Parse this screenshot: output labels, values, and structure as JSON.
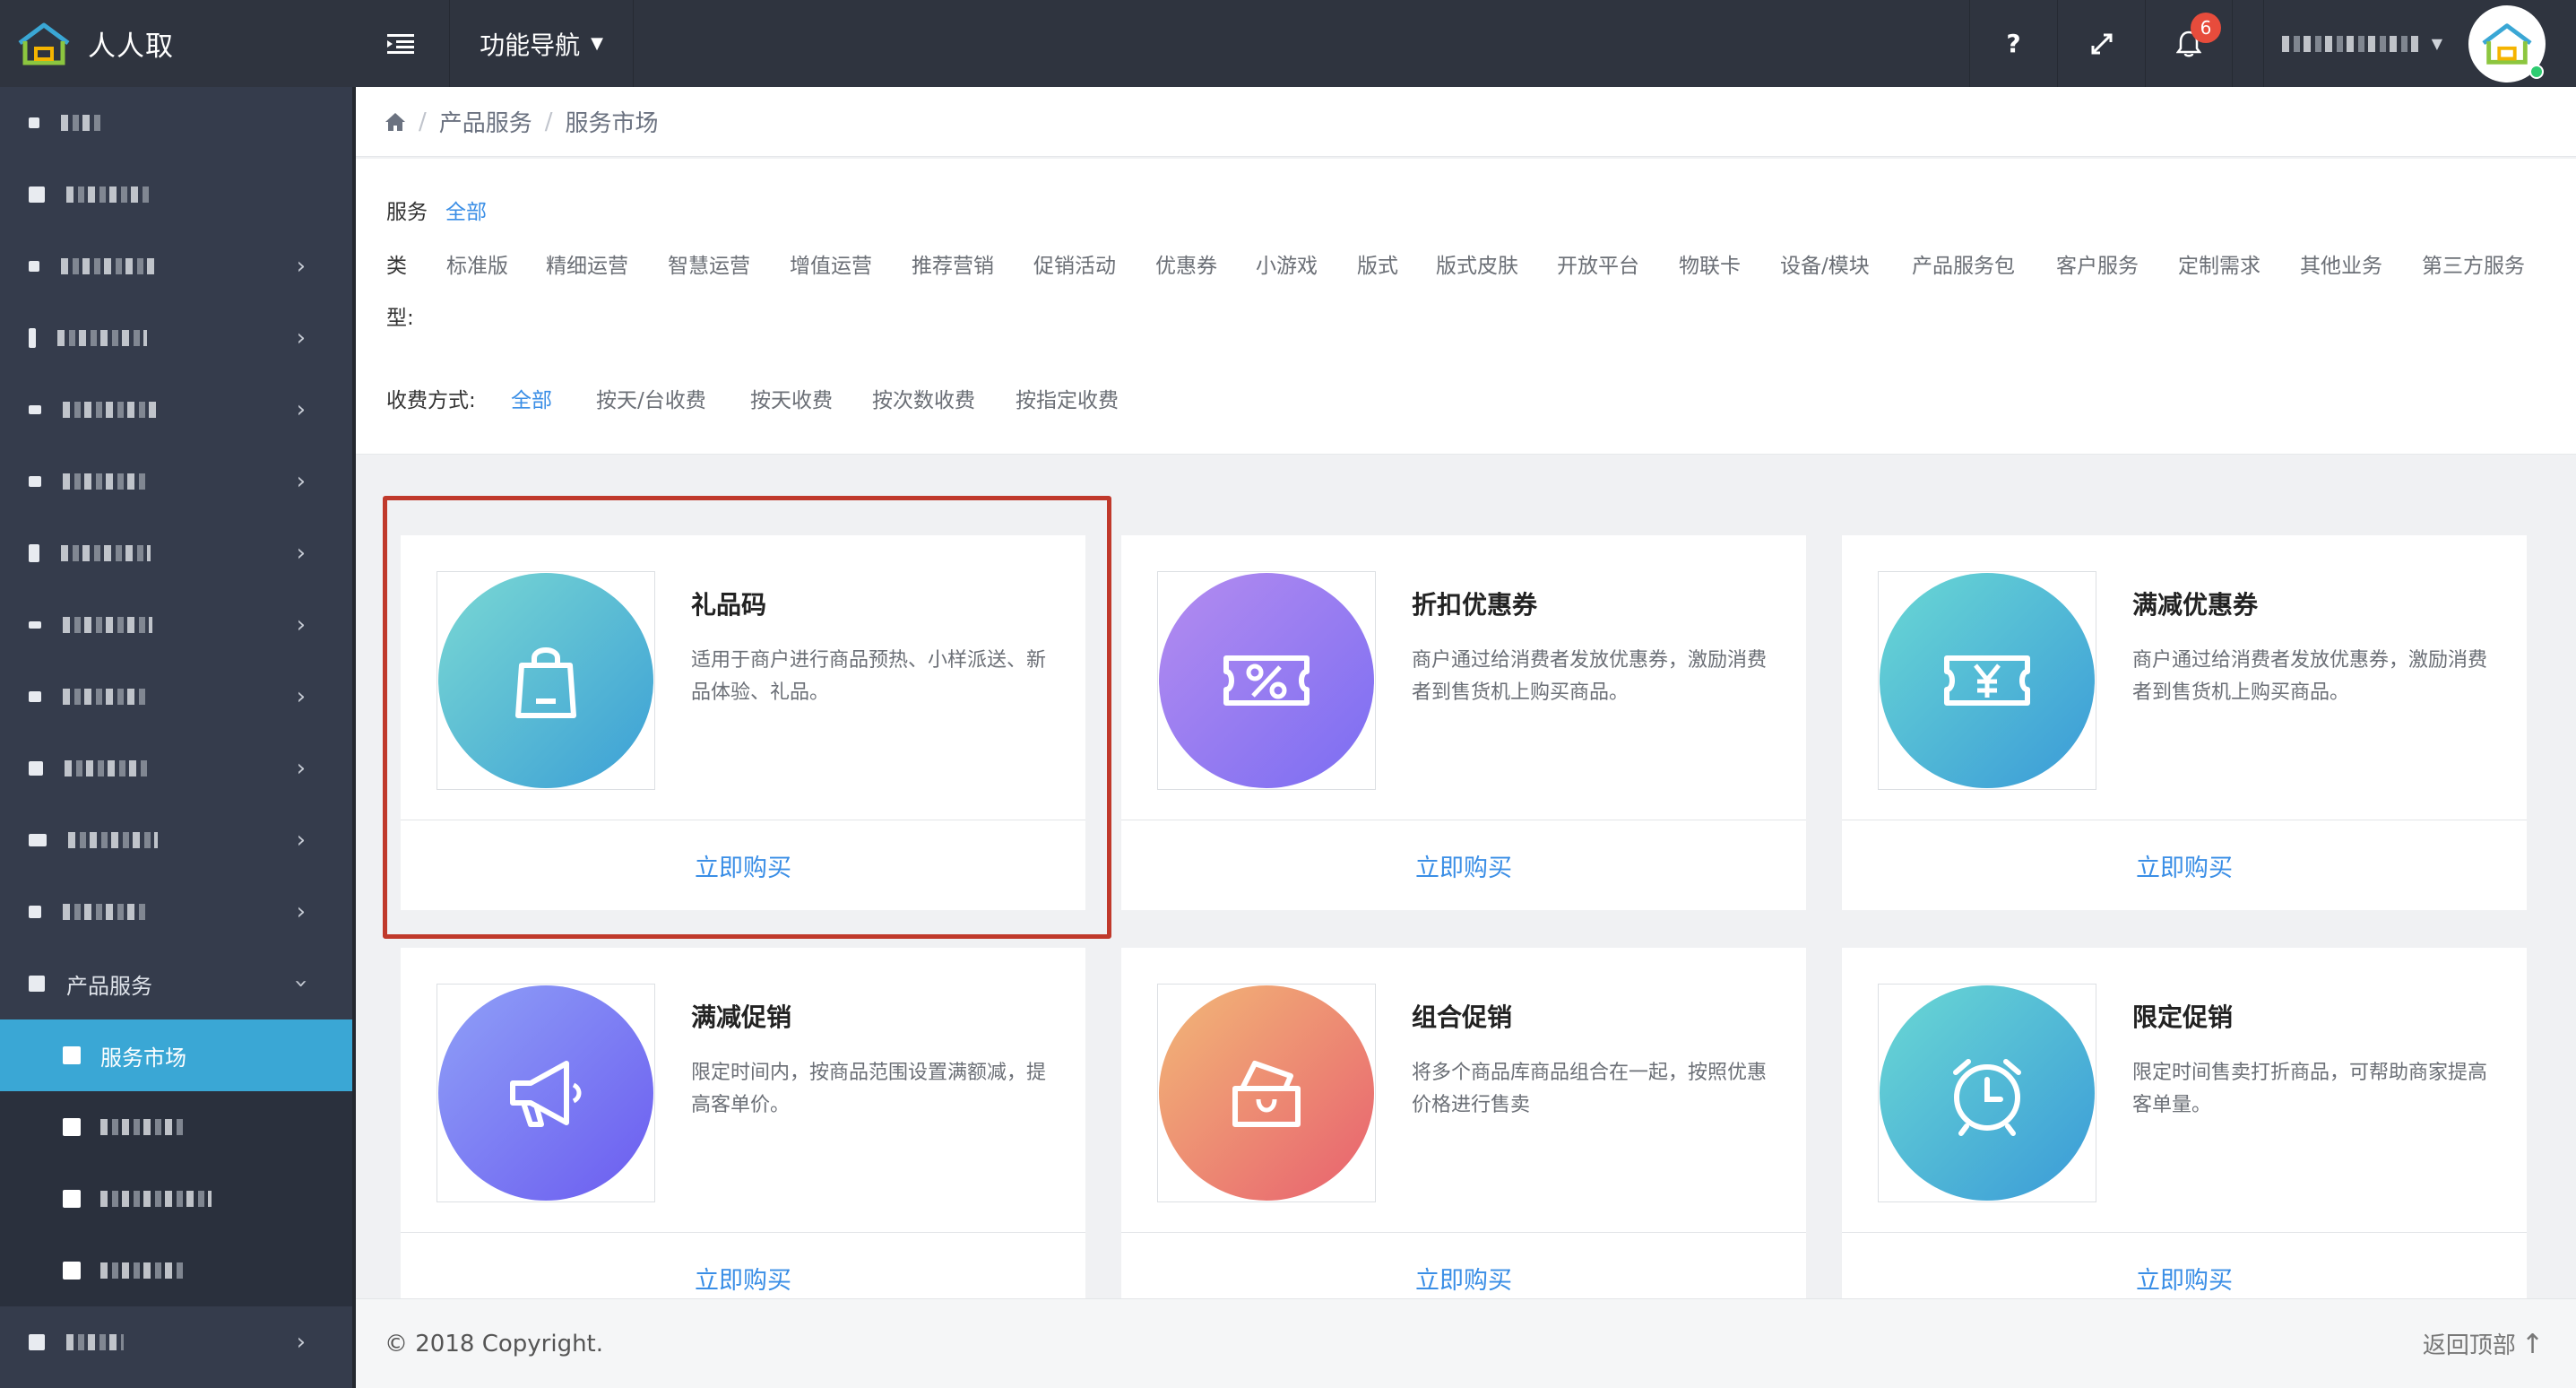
{
  "app": {
    "name": "人人取"
  },
  "topbar": {
    "func_nav": "功能导航",
    "help": "?",
    "notification_count": "6"
  },
  "sidebar": {
    "product_services": "产品服务",
    "service_market": "服务市场"
  },
  "breadcrumb": [
    "产品服务",
    "服务市场"
  ],
  "filters": {
    "service_label": "服务",
    "service_all": "全部",
    "type_label_1": "类",
    "type_label_2": "型:",
    "types": [
      "标准版",
      "精细运营",
      "智慧运营",
      "增值运营",
      "推荐营销",
      "促销活动",
      "优惠券",
      "小游戏",
      "版式",
      "版式皮肤",
      "开放平台",
      "物联卡",
      "设备/模块",
      "产品服务包",
      "客户服务",
      "定制需求",
      "其他业务",
      "第三方服务"
    ],
    "fee_label": "收费方式:",
    "fee_all": "全部",
    "fees": [
      "按天/台收费",
      "按天收费",
      "按次数收费",
      "按指定收费"
    ]
  },
  "cards": [
    {
      "title": "礼品码",
      "desc": "适用于商户进行商品预热、小样派送、新品体验、礼品。",
      "button": "立即购买",
      "icon": "shopping-bag-icon",
      "gradient": [
        "#7ad8d3",
        "#3b9fd6"
      ]
    },
    {
      "title": "折扣优惠券",
      "desc": "商户通过给消费者发放优惠券，激励消费者到售货机上购买商品。",
      "button": "立即购买",
      "icon": "percent-ticket-icon",
      "gradient": [
        "#b48cf0",
        "#7b6df2"
      ]
    },
    {
      "title": "满减优惠券",
      "desc": "商户通过给消费者发放优惠券，激励消费者到售货机上购买商品。",
      "button": "立即购买",
      "icon": "yen-ticket-icon",
      "gradient": [
        "#6ad8d4",
        "#3a9ad8"
      ]
    },
    {
      "title": "满减促销",
      "desc": "限定时间内，按商品范围设置满额减，提高客单价。",
      "button": "立即购买",
      "icon": "megaphone-icon",
      "gradient": [
        "#8fa0f7",
        "#6b5cf0"
      ]
    },
    {
      "title": "组合促销",
      "desc": "将多个商品库商品组合在一起，按照优惠价格进行售卖",
      "button": "立即购买",
      "icon": "combo-basket-icon",
      "gradient": [
        "#f2b877",
        "#e8606f"
      ]
    },
    {
      "title": "限定促销",
      "desc": "限定时间售卖打折商品，可帮助商家提高客单量。",
      "button": "立即购买",
      "icon": "alarm-clock-icon",
      "gradient": [
        "#6ad8d4",
        "#3a9ad8"
      ]
    }
  ],
  "footer": {
    "copyright": "© 2018 Copyright.",
    "back_to_top": "返回顶部"
  }
}
